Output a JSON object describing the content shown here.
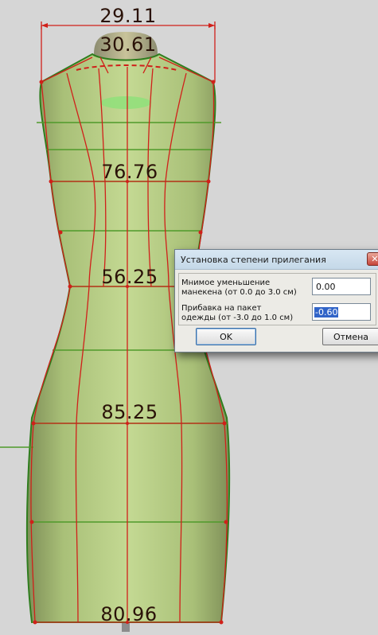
{
  "measurements": {
    "shoulder_width": "29.11",
    "neck": "30.61",
    "bust": "76.76",
    "waist": "56.25",
    "hips": "85.25",
    "hem": "80.96"
  },
  "dialog": {
    "title": "Установка степени прилегания",
    "close_symbol": "✕",
    "field1_label_line1": "Мнимое уменьшение",
    "field1_label_line2": "манекена (от 0.0 до 3.0 см)",
    "field1_value": "0.00",
    "field2_label_line1": "Прибавка на пакет",
    "field2_label_line2": "одежды (от -3.0 до 1.0 см)",
    "field2_value": "-0.60",
    "ok_label": "OK",
    "cancel_label": "Отмена"
  },
  "colors": {
    "background": "#d6d6d6",
    "body_fill": "#b7cf86",
    "grid_lines": "#4f9a2a",
    "construction_lines": "#d0201a",
    "measure_text": "#2a1208"
  }
}
